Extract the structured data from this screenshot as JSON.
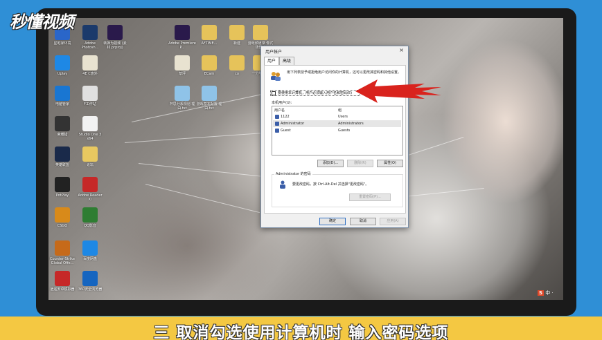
{
  "watermark": {
    "logo_text": "秒懂视频"
  },
  "desktop": {
    "icons_left": [
      {
        "label": "星吧家环境",
        "icon": "app-icon"
      },
      {
        "label": "Adobe Photosh...",
        "icon": "photoshop-icon"
      },
      {
        "label": "转换为视频 (素材.prproj)",
        "icon": "premiere-file-icon"
      },
      {
        "label": "Uplay",
        "icon": "uplay-icon"
      },
      {
        "label": "4E C盘外",
        "icon": "folder-icon"
      },
      {
        "label": "电脑管家",
        "icon": "shield-icon"
      },
      {
        "label": "F工作站",
        "icon": "app-icon"
      },
      {
        "label": "荣耀猎",
        "icon": "game-icon"
      },
      {
        "label": "Studio One 3 x64",
        "icon": "studio-one-icon"
      },
      {
        "label": "英雄联盟",
        "icon": "lol-icon"
      },
      {
        "label": "论坛",
        "icon": "file-icon"
      },
      {
        "label": "PotPlay",
        "icon": "potplayer-icon"
      },
      {
        "label": "Adobe Reader XI",
        "icon": "adobe-reader-icon"
      },
      {
        "label": "CSGO",
        "icon": "csgo-icon"
      },
      {
        "label": "QQ影音",
        "icon": "qq-music-icon"
      },
      {
        "label": "Counter-Strike Global Offe...",
        "icon": "cs-icon"
      },
      {
        "label": "百度网盘",
        "icon": "baidu-netdisk-icon"
      },
      {
        "label": "逍遥安卓模拟器",
        "icon": "emulator-icon"
      },
      {
        "label": "360安全浏览器",
        "icon": "browser-icon"
      }
    ],
    "icons_mid": [
      {
        "label": "Adobe Premiere P...",
        "icon": "premiere-icon"
      },
      {
        "label": "AFTIME...",
        "icon": "folder-icon"
      },
      {
        "label": "新建",
        "icon": "folder-icon"
      },
      {
        "label": "游戏频道录 像式场景库",
        "icon": "folder-icon"
      },
      {
        "label": "草坪",
        "icon": "file-icon"
      },
      {
        "label": "ECam",
        "icon": "folder-icon"
      },
      {
        "label": "co",
        "icon": "folder-icon"
      },
      {
        "label": "一分学员库",
        "icon": "folder-icon"
      },
      {
        "label": "杯思分系规划 理由.txt",
        "icon": "txt-icon"
      },
      {
        "label": "游戏基本配置 理由.txt",
        "icon": "txt-icon"
      }
    ]
  },
  "dialog": {
    "title": "用户帐户",
    "close_glyph": "×",
    "tabs": [
      "用户",
      "高级"
    ],
    "intro": "用下列表授予或拒绝用户访问你的计算机，还可以更改其密码和其他设置。",
    "checkbox_label": "要使用本计算机，用户必须输入用户名和密码(E)",
    "checkbox_checked": false,
    "list_label": "本机用户(U):",
    "columns": [
      "用户名",
      "组"
    ],
    "users": [
      {
        "name": "1122",
        "group": "Users"
      },
      {
        "name": "Administrator",
        "group": "Administrators"
      },
      {
        "name": "Guest",
        "group": "Guests"
      }
    ],
    "buttons_row": {
      "add": "添加(D)...",
      "remove": "删除(R)",
      "properties": "属性(O)"
    },
    "password_section": {
      "title": "Administrator 的密码",
      "text": "要更改密码，按 Ctrl-Alt-Del 并选择\"更改密码\"。",
      "reset_button": "重置密码(P)..."
    },
    "footer": {
      "ok": "确定",
      "cancel": "取消",
      "apply": "应用(A)"
    }
  },
  "tray": {
    "ime_badge": "S",
    "ime_text": "中 ·"
  },
  "caption": "三 取消勾选使用计算机时 输入密码选项",
  "colors": {
    "caption_bg": "#f4c842",
    "outer_bg": "#2f8fd6",
    "arrow": "#d9231d"
  }
}
